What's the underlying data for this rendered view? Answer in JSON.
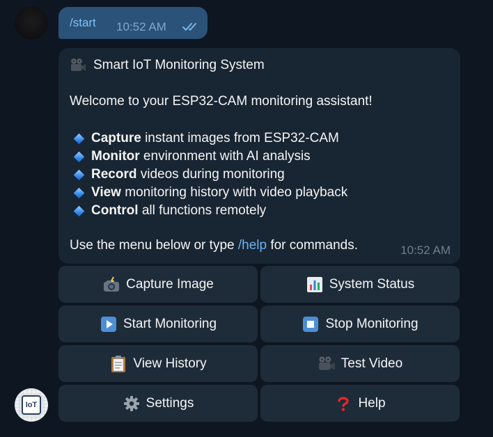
{
  "outgoing": {
    "text": "/start",
    "time": "10:52 AM",
    "status_icon": "double-check-icon"
  },
  "incoming": {
    "title": "Smart IoT Monitoring System",
    "title_icon": "movie-camera-icon",
    "welcome": "Welcome to your ESP32-CAM monitoring assistant!",
    "features": [
      {
        "bold": "Capture",
        "rest": " instant images from ESP32-CAM"
      },
      {
        "bold": "Monitor",
        "rest": " environment with AI analysis"
      },
      {
        "bold": "Record",
        "rest": " videos during monitoring"
      },
      {
        "bold": "View",
        "rest": " monitoring history with video playback"
      },
      {
        "bold": "Control",
        "rest": " all functions remotely"
      }
    ],
    "footer_prefix": "Use the menu below or type ",
    "footer_link": "/help",
    "footer_suffix": " for commands.",
    "time": "10:52 AM"
  },
  "bot_avatar_label": "IoT",
  "keyboard": {
    "capture_image": "Capture Image",
    "system_status": "System Status",
    "start_monitoring": "Start Monitoring",
    "stop_monitoring": "Stop Monitoring",
    "view_history": "View History",
    "test_video": "Test Video",
    "settings": "Settings",
    "help": "Help"
  },
  "colors": {
    "background": "#0e1621",
    "outgoing_bubble": "#2b5278",
    "incoming_bubble": "#182533",
    "keyboard_button": "#1e2c3a",
    "link": "#6ab3f3"
  }
}
